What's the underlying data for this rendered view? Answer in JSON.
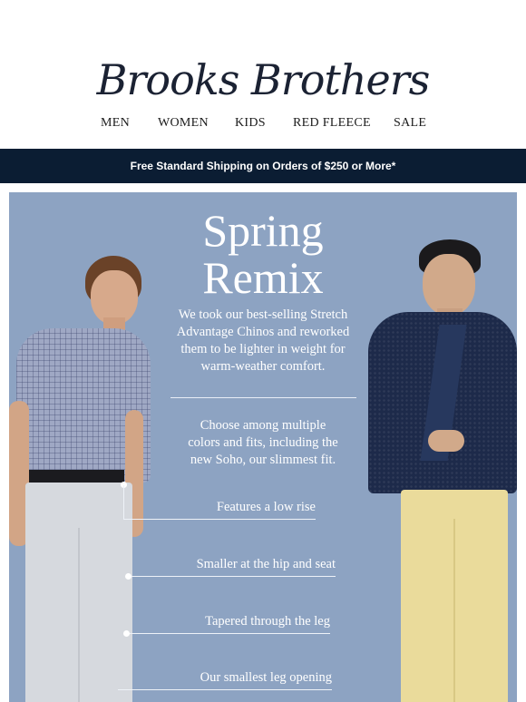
{
  "brand": {
    "logo_text": "Brooks Brothers"
  },
  "nav": {
    "items": [
      "MEN",
      "WOMEN",
      "KIDS",
      "RED FLEECE",
      "SALE"
    ]
  },
  "promo_bar": {
    "text": "Free Standard Shipping on Orders of $250 or More*"
  },
  "hero": {
    "title_line1": "Spring",
    "title_line2": "Remix",
    "intro_line1": "We took our best-selling Stretch",
    "intro_line2": "Advantage Chinos and reworked",
    "intro_line3": "them to be lighter in weight for",
    "intro_line4": "warm-weather comfort.",
    "choose_line1": "Choose among multiple",
    "choose_line2": "colors and fits, including the",
    "choose_line3": "new Soho, our slimmest fit.",
    "features": [
      "Features a low rise",
      "Smaller at the hip and seat",
      "Tapered through the leg",
      "Our smallest leg opening"
    ]
  },
  "colors": {
    "hero_background": "#8da3c2",
    "promo_bar": "#0b1d33",
    "logo": "#1b2233"
  }
}
